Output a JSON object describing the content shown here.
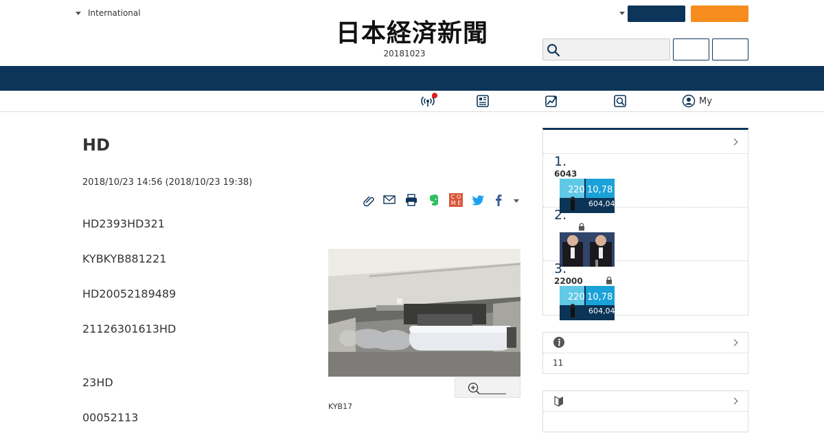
{
  "header": {
    "region_label": "International",
    "logo_text": "日本経済新聞",
    "edition_date": "20181023",
    "search_placeholder": ""
  },
  "subnav": {
    "my_label": "My"
  },
  "article": {
    "title": "HD",
    "timestamp": "2018/10/23 14:56 (2018/10/23 19:38)",
    "paragraphs": [
      "HD2393HD321",
      "KYBKYB881221",
      "HD20052189489",
      "21126301613HD",
      "23HD",
      "00052113"
    ],
    "photo_caption": "KYB17"
  },
  "sidebar": {
    "ranking": [
      {
        "rank": "1.",
        "text": "6043",
        "locked": false
      },
      {
        "rank": "2.",
        "text": "",
        "locked": true
      },
      {
        "rank": "3.",
        "text": "22000",
        "locked": true
      }
    ],
    "ticker_numbers": [
      "220",
      "10,78",
      "604,04"
    ],
    "info_text": "11"
  },
  "colors": {
    "navy": "#0d3459",
    "orange": "#f78c1e",
    "rank_number": "#0d3459",
    "live_dot": "#e01b1b",
    "twitter": "#1da1f2",
    "facebook": "#3b5998",
    "evernote": "#2dbe60",
    "comemo": "#d9573a"
  },
  "icons": {
    "share_icons": [
      "clip-icon",
      "mail-icon",
      "print-icon",
      "evernote-icon",
      "comemo-icon",
      "twitter-icon",
      "facebook-icon",
      "more-caret-icon"
    ],
    "subnav_icons": [
      "live-broadcast-icon",
      "newspaper-icon",
      "market-chart-icon",
      "search-news-icon",
      "my-account-icon"
    ]
  }
}
